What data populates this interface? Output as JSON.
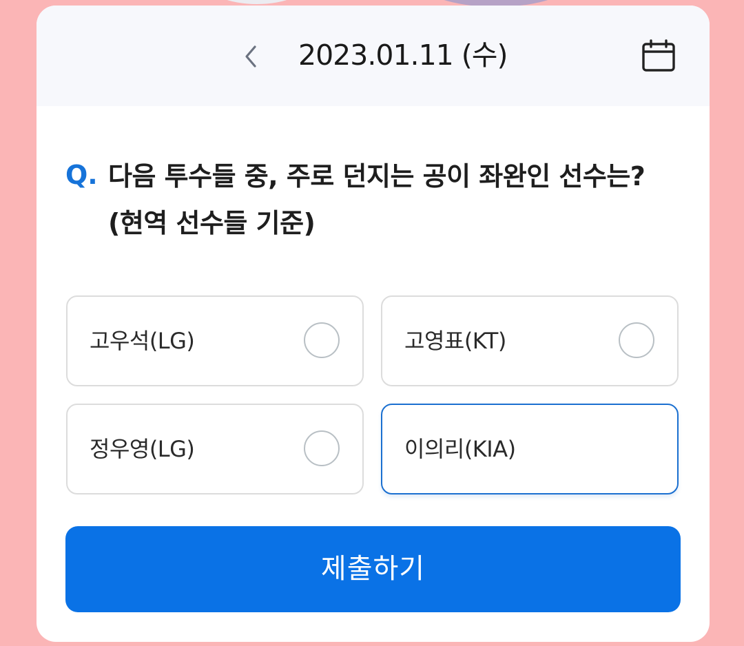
{
  "date_bar": {
    "date_text": "2023.01.11 (수)",
    "prev_icon": "chevron-left-icon",
    "calendar_icon": "calendar-icon"
  },
  "question": {
    "prefix": "Q.",
    "text": "다음 투수들 중, 주로 던지는 공이 좌완인 선수는? (현역 선수들 기준)"
  },
  "options": [
    {
      "label": "고우석(LG)",
      "selected": false
    },
    {
      "label": "고영표(KT)",
      "selected": false
    },
    {
      "label": "정우영(LG)",
      "selected": false
    },
    {
      "label": "이의리(KIA)",
      "selected": true
    }
  ],
  "submit": {
    "label": "제출하기"
  },
  "colors": {
    "background": "#fbb5b6",
    "accent": "#0a72e6",
    "question_prefix": "#1673d9",
    "selected_border": "#1a6fd0"
  }
}
